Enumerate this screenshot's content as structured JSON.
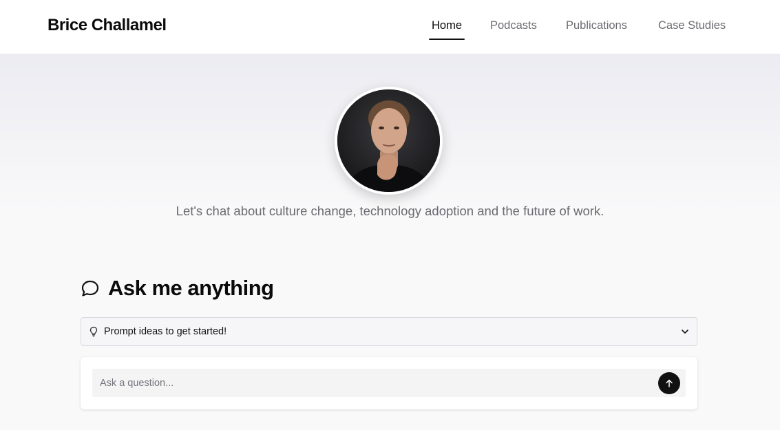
{
  "header": {
    "brand": "Brice Challamel",
    "nav": [
      {
        "label": "Home",
        "active": true
      },
      {
        "label": "Podcasts",
        "active": false
      },
      {
        "label": "Publications",
        "active": false
      },
      {
        "label": "Case Studies",
        "active": false
      }
    ]
  },
  "hero": {
    "avatar_icon": "portrait-photo",
    "tagline": "Let's chat about culture change, technology adoption and the future of work."
  },
  "ask": {
    "title": "Ask me anything",
    "title_icon": "chat-bubble-icon",
    "prompt_ideas_label": "Prompt ideas to get started!",
    "prompt_ideas_icon": "lightbulb-icon",
    "dropdown_icon": "chevron-down-icon",
    "input_value": "",
    "input_placeholder": "Ask a question...",
    "send_icon": "arrow-up-icon"
  },
  "colors": {
    "accent": "#111111",
    "muted_text": "#6b6b72",
    "background": "#f9f9fa"
  }
}
